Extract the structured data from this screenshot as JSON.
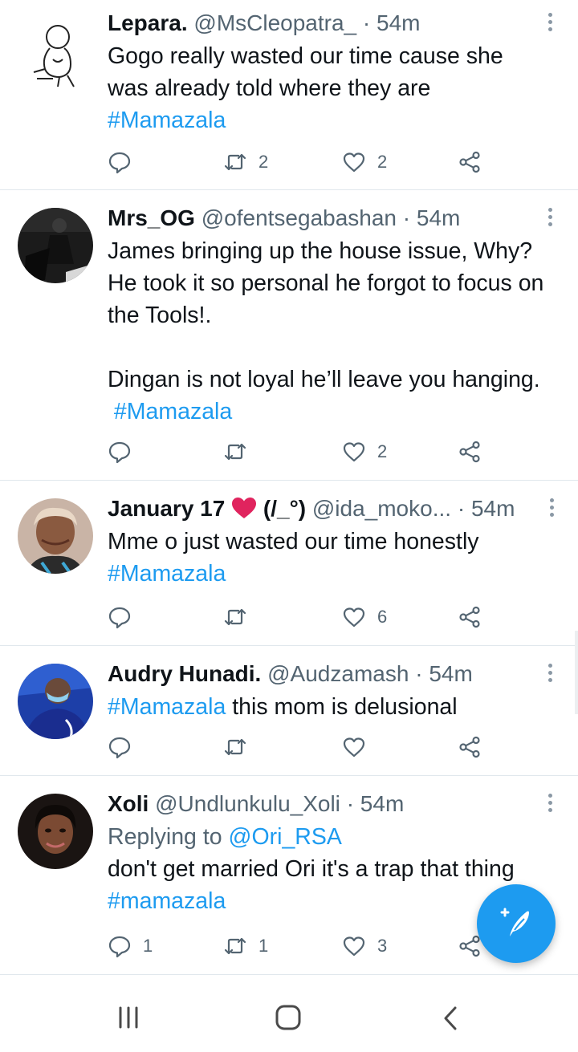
{
  "tweets": [
    {
      "name": "Lepara.",
      "handle": "@MsCleopatra_",
      "separator": "·",
      "time": "54m",
      "text": "Gogo really wasted our time cause she was already told where they are",
      "hashtag": "#Mamazala",
      "stats": {
        "replies": "",
        "retweets": "2",
        "likes": "2"
      },
      "avatar_icon": "sketch-person-avatar"
    },
    {
      "name": "Mrs_OG",
      "handle": "@ofentsegabashan",
      "separator": "·",
      "time": "54m",
      "text": "James bringing up the house issue, Why? He took it so personal he forgot to focus on the Tools!.\n\nDingan is not loyal he’ll leave you hanging.",
      "hashtag": " #Mamazala",
      "stats": {
        "replies": "",
        "retweets": "",
        "likes": "2"
      },
      "avatar_icon": "photo-avatar"
    },
    {
      "name": "January 17",
      "name_suffix": "(/_°)",
      "handle": "@ida_moko...",
      "separator": "·",
      "time": "54m",
      "text": "Mme o just wasted our time honestly",
      "hashtag": "#Mamazala",
      "stats": {
        "replies": "",
        "retweets": "",
        "likes": "6"
      },
      "avatar_icon": "photo-avatar"
    },
    {
      "name": "Audry Hunadi.",
      "handle": "@Audzamash",
      "separator": "·",
      "time": "54m",
      "hashtag": "#Mamazala",
      "text": " this mom is delusional",
      "stats": {
        "replies": "",
        "retweets": "",
        "likes": ""
      },
      "avatar_icon": "photo-avatar"
    },
    {
      "name": "Xoli",
      "handle": "@Undlunkulu_Xoli",
      "separator": "·",
      "time": "54m",
      "replying_prefix": "Replying to ",
      "replying_to": "@Ori_RSA",
      "text": "don't get married Ori it's a trap that thing",
      "hashtag": "#mamazala",
      "stats": {
        "replies": "1",
        "retweets": "1",
        "likes": "3"
      },
      "avatar_icon": "photo-avatar"
    }
  ],
  "fab": {
    "icon": "compose-tweet-icon",
    "color": "#1d9bf0"
  },
  "navbar": {
    "recents_icon": "recents-icon",
    "home_icon": "home-icon",
    "back_icon": "back-icon"
  },
  "colors": {
    "accent": "#1d9bf0",
    "secondary_text": "#536471",
    "divider": "#e1e8ed",
    "heart_emoji": "#e0245e"
  }
}
